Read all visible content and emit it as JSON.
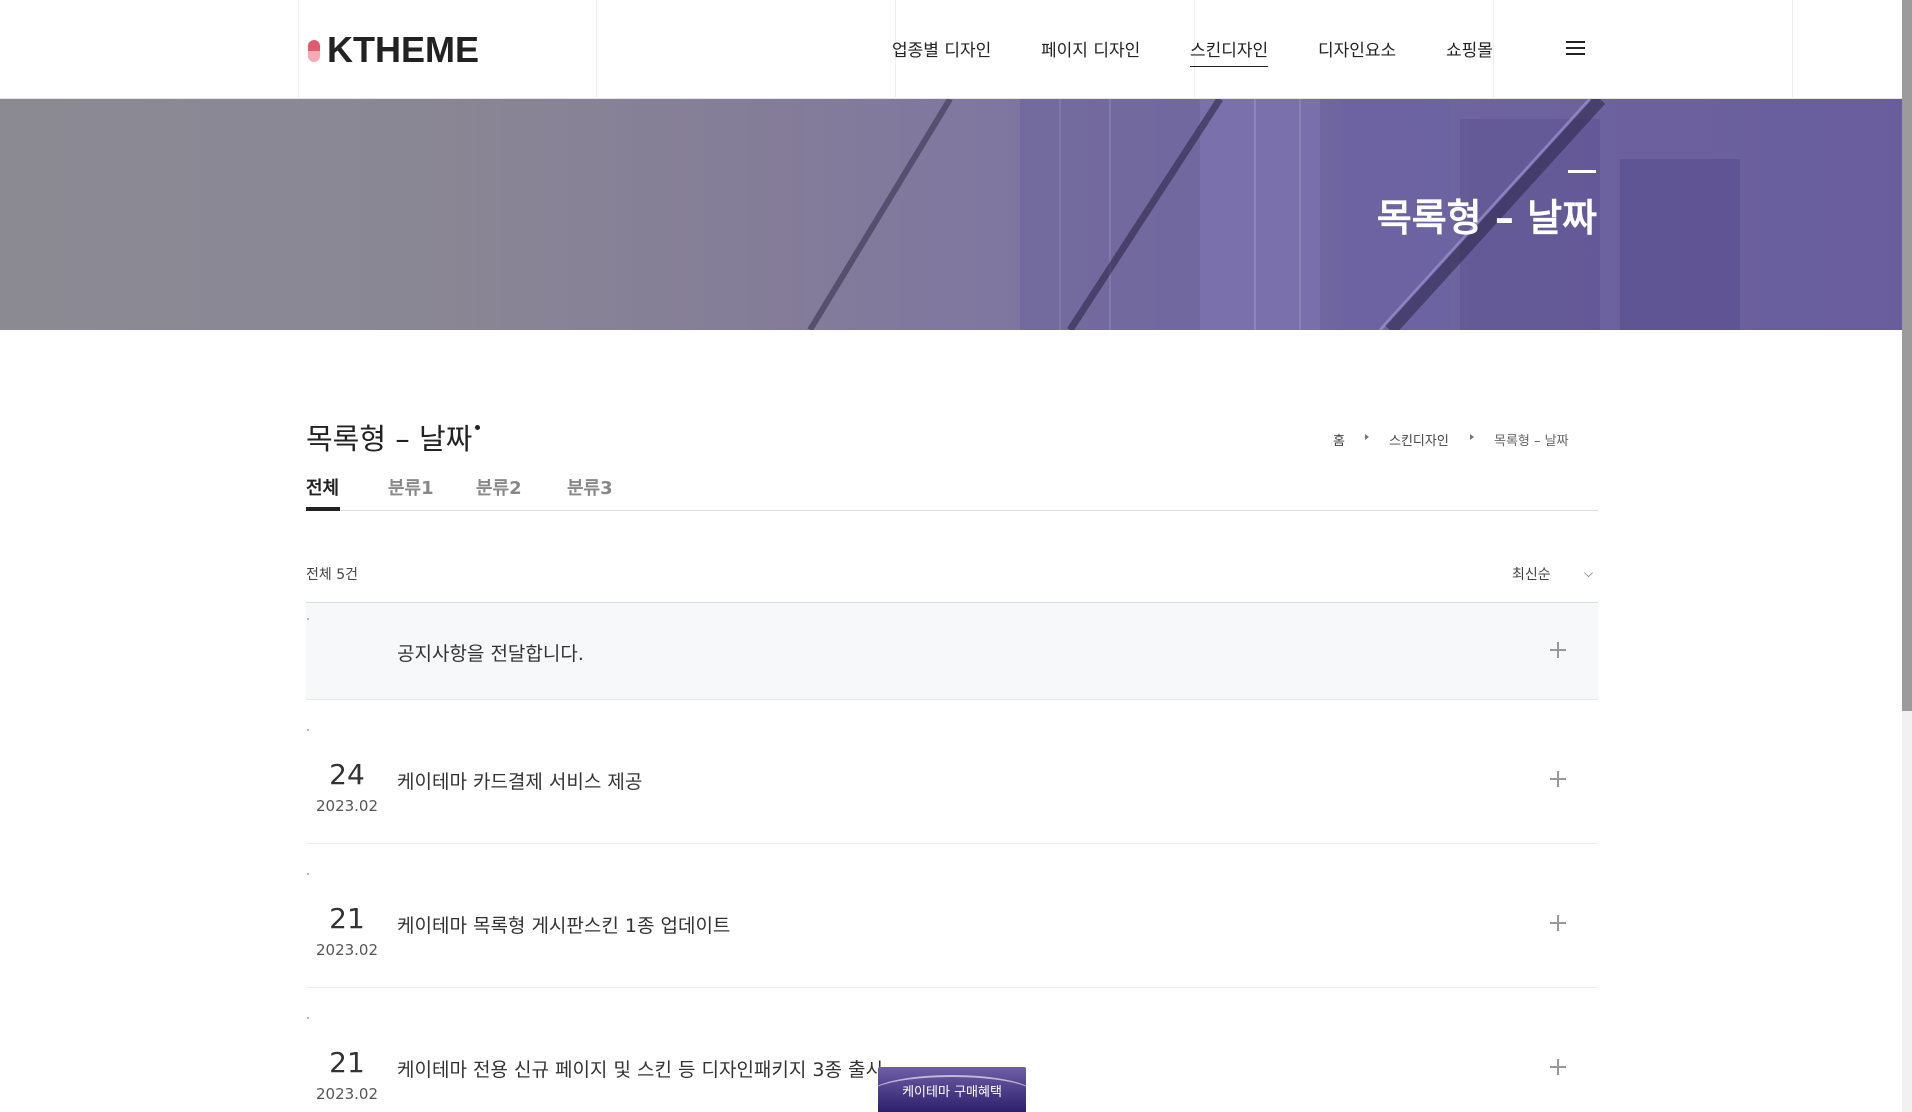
{
  "header": {
    "logo_text": "KTHEME",
    "nav": [
      "업종별 디자인",
      "페이지 디자인",
      "스킨디자인",
      "디자인요소",
      "쇼핑몰"
    ],
    "active_nav": "스킨디자인",
    "menu_icon": "hamburger-menu-icon"
  },
  "hero": {
    "title": "목록형 – 날짜"
  },
  "board": {
    "title": "목록형 – 날짜",
    "breadcrumb": [
      "홈",
      "스킨디자인",
      "목록형 – 날짜"
    ],
    "tabs": [
      "전체",
      "분류1",
      "분류2",
      "분류3"
    ],
    "active_tab": "전체",
    "total_label": "전체 5건",
    "sort_label": "최신순",
    "sort_icon": "chevron-down-icon",
    "rows": [
      {
        "type": "notice",
        "day": "",
        "ym": "",
        "title": "공지사항을 전달합니다."
      },
      {
        "type": "post",
        "day": "24",
        "ym": "2023.02",
        "title": "케이테마 카드결제 서비스 제공"
      },
      {
        "type": "post",
        "day": "21",
        "ym": "2023.02",
        "title": "케이테마 목록형 게시판스킨 1종 업데이트"
      },
      {
        "type": "post",
        "day": "21",
        "ym": "2023.02",
        "title": "케이테마 전용 신규 페이지 및 스킨 등 디자인패키지 3종 출시"
      }
    ],
    "row_icon": "plus-icon"
  },
  "float_button": {
    "label": "케이테마 구매혜택"
  },
  "colors": {
    "hero_tint": "#7468a6",
    "logo_accent": "#e25a6e",
    "float_button": "#3b2c7c"
  }
}
